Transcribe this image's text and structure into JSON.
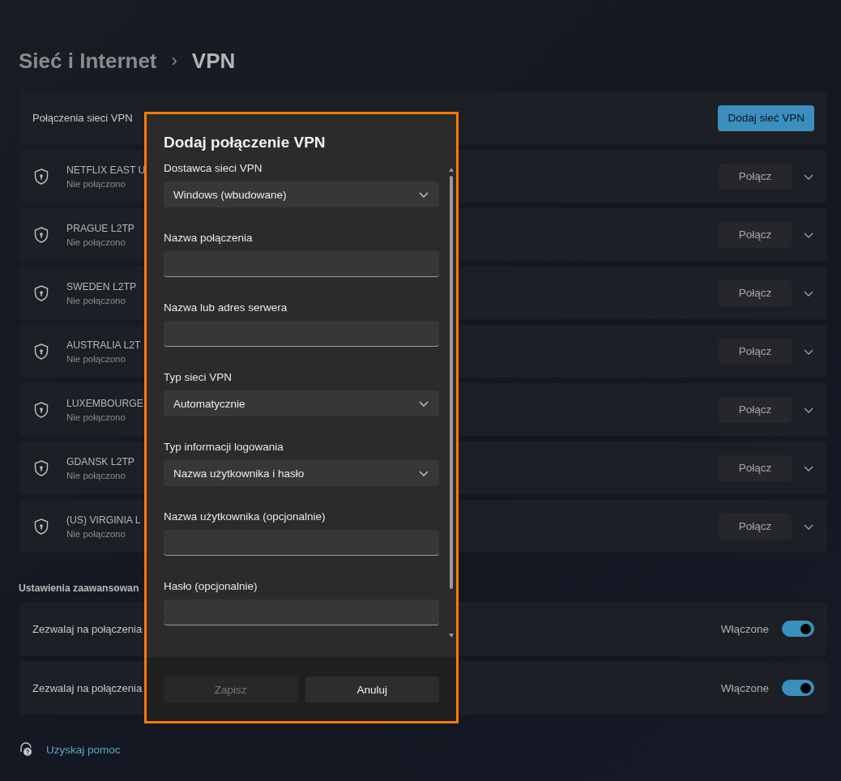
{
  "breadcrumb": {
    "parent": "Sieć i Internet",
    "separator": "›",
    "current": "VPN"
  },
  "header": {
    "label": "Połączenia sieci VPN",
    "button": "Dodaj sieć VPN"
  },
  "connections": [
    {
      "name": "NETFLIX EAST U",
      "status": "Nie połączono",
      "button": "Połącz",
      "expanded": false
    },
    {
      "name": "PRAGUE L2TP",
      "status": "Nie połączono",
      "button": "Połącz",
      "expanded": false
    },
    {
      "name": "SWEDEN L2TP",
      "status": "Nie połączono",
      "button": "Połącz",
      "expanded": false
    },
    {
      "name": "AUSTRALIA L2T",
      "status": "Nie połączono",
      "button": "Połącz",
      "expanded": false
    },
    {
      "name": "LUXEMBOURGE",
      "status": "Nie połączono",
      "button": "Połącz",
      "expanded": false
    },
    {
      "name": "GDANSK L2TP",
      "status": "Nie połączono",
      "button": "Połącz",
      "expanded": false
    },
    {
      "name": "(US) VIRGINIA L",
      "status": "Nie połączono",
      "button": "Połącz",
      "expanded": false
    }
  ],
  "advanced": {
    "title": "Ustawienia zaawansowan",
    "settings": [
      {
        "label": "Zezwalaj na połączenia",
        "state": "Włączone",
        "on": true
      },
      {
        "label": "Zezwalaj na połączenia",
        "state": "Włączone",
        "on": true
      }
    ]
  },
  "help": {
    "label": "Uzyskaj pomoc"
  },
  "dialog": {
    "title": "Dodaj połączenie VPN",
    "fields": [
      {
        "kind": "select",
        "label": "Dostawca sieci VPN",
        "value": "Windows (wbudowane)"
      },
      {
        "kind": "text",
        "label": "Nazwa połączenia"
      },
      {
        "kind": "text",
        "label": "Nazwa lub adres serwera"
      },
      {
        "kind": "select",
        "label": "Typ sieci VPN",
        "value": "Automatycznie"
      },
      {
        "kind": "select",
        "label": "Typ informacji logowania",
        "value": "Nazwa użytkownika i hasło"
      },
      {
        "kind": "text",
        "label": "Nazwa użytkownika (opcjonalnie)"
      },
      {
        "kind": "text",
        "label": "Hasło (opcjonalnie)"
      }
    ],
    "buttons": [
      {
        "label": "Zapisz",
        "disabled": true
      },
      {
        "label": "Anuluj",
        "disabled": false
      }
    ]
  }
}
